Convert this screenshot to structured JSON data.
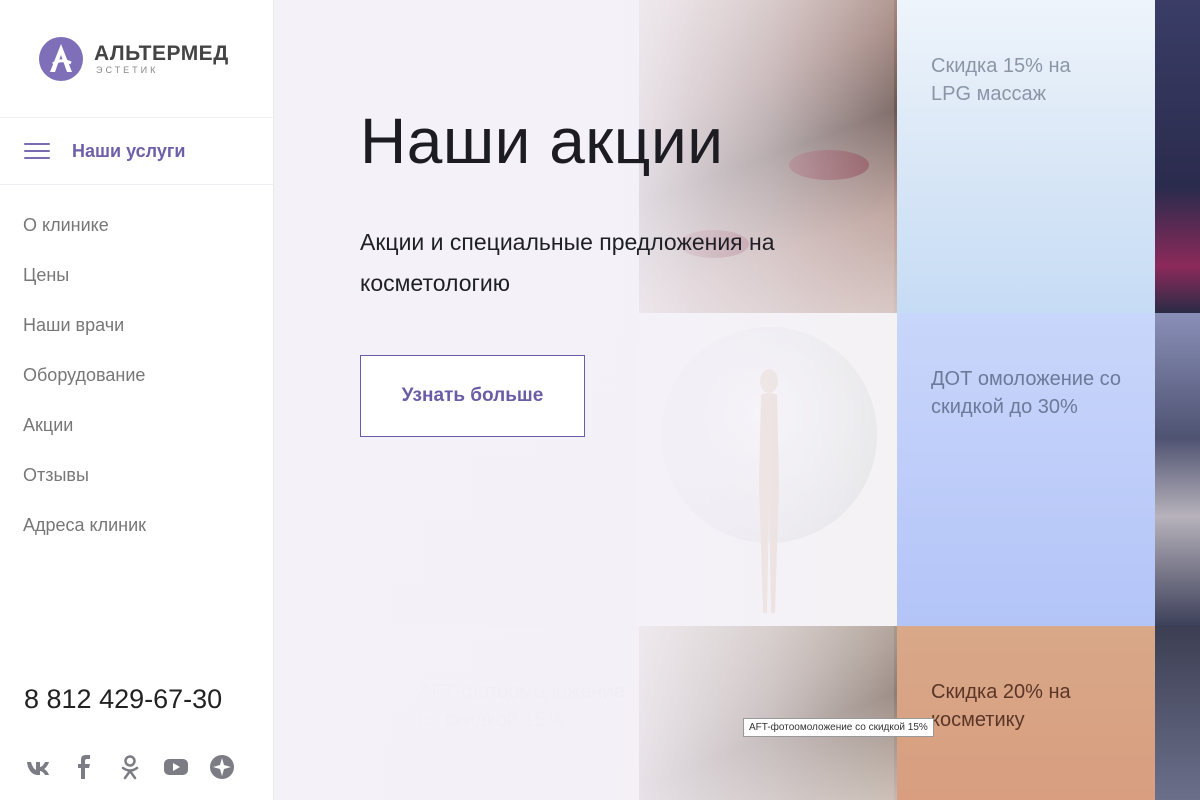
{
  "brand": {
    "name": "АЛЬТЕРМЕД",
    "sub": "ЭСТЕТИК",
    "accent": "#6f5fa8"
  },
  "sidebar": {
    "services_label": "Наши услуги",
    "nav": [
      {
        "label": "О клинике"
      },
      {
        "label": "Цены"
      },
      {
        "label": "Наши врачи"
      },
      {
        "label": "Оборудование"
      },
      {
        "label": "Акции"
      },
      {
        "label": "Отзывы"
      },
      {
        "label": "Адреса клиник"
      }
    ],
    "phone": "8 812 429-67-30",
    "socials": [
      "vk-icon",
      "facebook-icon",
      "odnoklassniki-icon",
      "youtube-icon",
      "star-icon"
    ]
  },
  "hero": {
    "title": "Наши акции",
    "subtitle": "Акции и специальные предложения на косметологию",
    "button_label": "Узнать больше"
  },
  "tiles": {
    "lpg": "Скидка 15% на LPG массаж",
    "dot": "ДОТ омоложение со скидкой до 30%",
    "aft": "AFT-фотоомоложение со скидкой 15%",
    "cosmetics": "Скидка 20% на косметику"
  },
  "tooltip": "AFT-фотоомоложение со скидкой 15%"
}
